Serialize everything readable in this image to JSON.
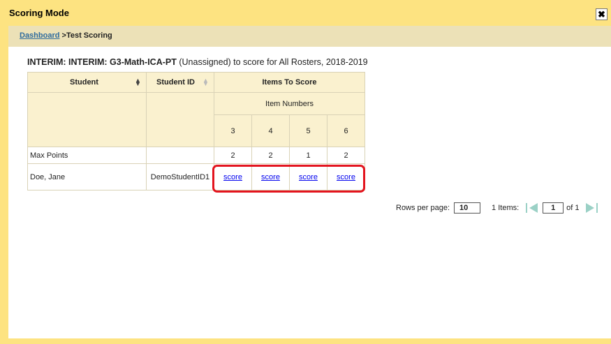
{
  "window": {
    "title": "Scoring Mode",
    "close_glyph": "✖"
  },
  "breadcrumb": {
    "link": "Dashboard",
    "separator": " >",
    "current": "Test Scoring"
  },
  "heading": {
    "bold": "INTERIM: INTERIM: G3-Math-ICA-PT",
    "rest": " (Unassigned) to score for All Rosters, 2018-2019"
  },
  "table": {
    "col_student": "Student",
    "col_student_id": "Student ID",
    "col_items": "Items To Score",
    "col_item_numbers": "Item Numbers",
    "item_numbers": [
      "3",
      "4",
      "5",
      "6"
    ],
    "max_points_label": "Max Points",
    "max_points": [
      "2",
      "2",
      "1",
      "2"
    ],
    "rows": [
      {
        "student": "Doe, Jane",
        "student_id": "DemoStudentID1",
        "links": [
          "score",
          "score",
          "score",
          "score"
        ]
      }
    ]
  },
  "pagination": {
    "rows_per_page_label": "Rows per page:",
    "rows_per_page": "10",
    "items_label": "1 Items:",
    "page": "1",
    "of_label": "of 1"
  },
  "colors": {
    "frame": "#fde381",
    "breadcrumb_bg": "#ece1b7",
    "header_bg": "#faf1cf",
    "highlight": "#e3141e",
    "arrow": "#9bd1c6"
  }
}
